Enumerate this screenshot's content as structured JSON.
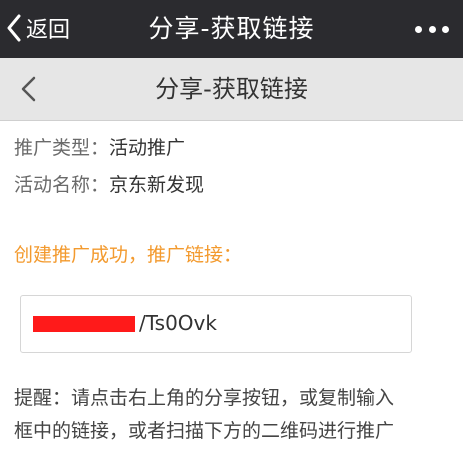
{
  "topbar": {
    "back_label": "返回",
    "title": "分享-获取链接",
    "more_icon": "more-dots-icon"
  },
  "subbar": {
    "title": "分享-获取链接",
    "back_icon": "chevron-left-icon"
  },
  "info": {
    "type_label": "推广类型：",
    "type_value": "活动推广",
    "name_label": "活动名称：",
    "name_value": "京东新发现"
  },
  "success_text": "创建推广成功，推广链接：",
  "link": {
    "visible_value": "/Ts0Ovk"
  },
  "tip": {
    "line1": "提醒：请点击右上角的分享按钮，或复制输入",
    "line2": "框中的链接，或者扫描下方的二维码进行推广"
  },
  "colors": {
    "topbar_bg": "#2b2b2f",
    "subbar_bg": "#e6e6e6",
    "accent_orange": "#f39a2e",
    "redaction": "#ff1a1a"
  }
}
